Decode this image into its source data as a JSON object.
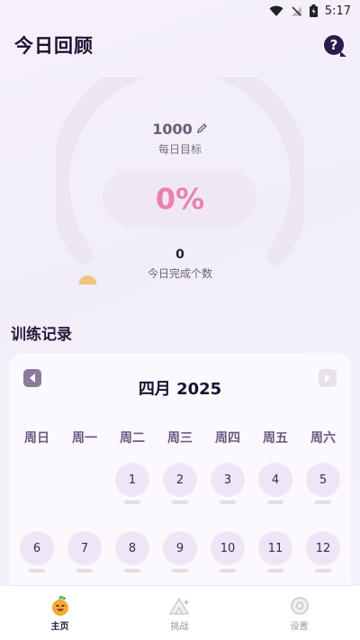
{
  "status": {
    "time": "5:17"
  },
  "header": {
    "title": "今日回顾"
  },
  "goal": {
    "value": "1000",
    "label": "每日目标"
  },
  "progress": {
    "percent_text": "0%",
    "fraction": 0
  },
  "completed": {
    "count": "0",
    "label": "今日完成个数"
  },
  "training": {
    "title": "训练记录"
  },
  "calendar": {
    "month_label": "四月 2025",
    "weekdays": [
      "周日",
      "周一",
      "周二",
      "周三",
      "周四",
      "周五",
      "周六"
    ],
    "row1": [
      "1",
      "2",
      "3",
      "4",
      "5"
    ],
    "row2": [
      "6",
      "7",
      "8",
      "9",
      "10",
      "11",
      "12"
    ]
  },
  "nav": {
    "items": [
      {
        "label": "主页",
        "icon": "smiley-fruit-icon",
        "active": true
      },
      {
        "label": "挑战",
        "icon": "challenge-icon",
        "active": false
      },
      {
        "label": "设置",
        "icon": "gear-icon",
        "active": false
      }
    ]
  },
  "colors": {
    "accent_pink": "#ec7fb1",
    "gauge_knob": "#f2c37d",
    "day_circle": "#eee6f6"
  }
}
